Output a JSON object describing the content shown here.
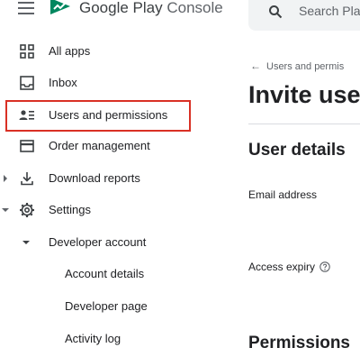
{
  "header": {
    "brand_primary": "Google Play",
    "brand_secondary": "Console",
    "search_placeholder": "Search Play"
  },
  "sidebar": {
    "items": [
      {
        "label": "All apps",
        "icon": "grid-icon"
      },
      {
        "label": "Inbox",
        "icon": "inbox-icon"
      },
      {
        "label": "Users and permissions",
        "icon": "people-icon",
        "highlighted": true
      },
      {
        "label": "Order management",
        "icon": "credit-card-icon"
      },
      {
        "label": "Download reports",
        "icon": "download-icon",
        "expandable": true,
        "expanded": false
      },
      {
        "label": "Settings",
        "icon": "gear-icon",
        "expandable": true,
        "expanded": true
      }
    ],
    "developer_account": {
      "label": "Developer account",
      "expanded": true,
      "children": [
        "Account details",
        "Developer page",
        "Activity log"
      ]
    }
  },
  "main": {
    "breadcrumb": "Users and permis",
    "title": "Invite use",
    "section_user_details": "User details",
    "email_label": "Email address",
    "access_expiry_label": "Access expiry",
    "section_permissions": "Permissions"
  },
  "colors": {
    "highlight_border": "#d93025",
    "logo_green": "#01875f",
    "text_primary": "#202124",
    "text_secondary": "#5f6368"
  }
}
